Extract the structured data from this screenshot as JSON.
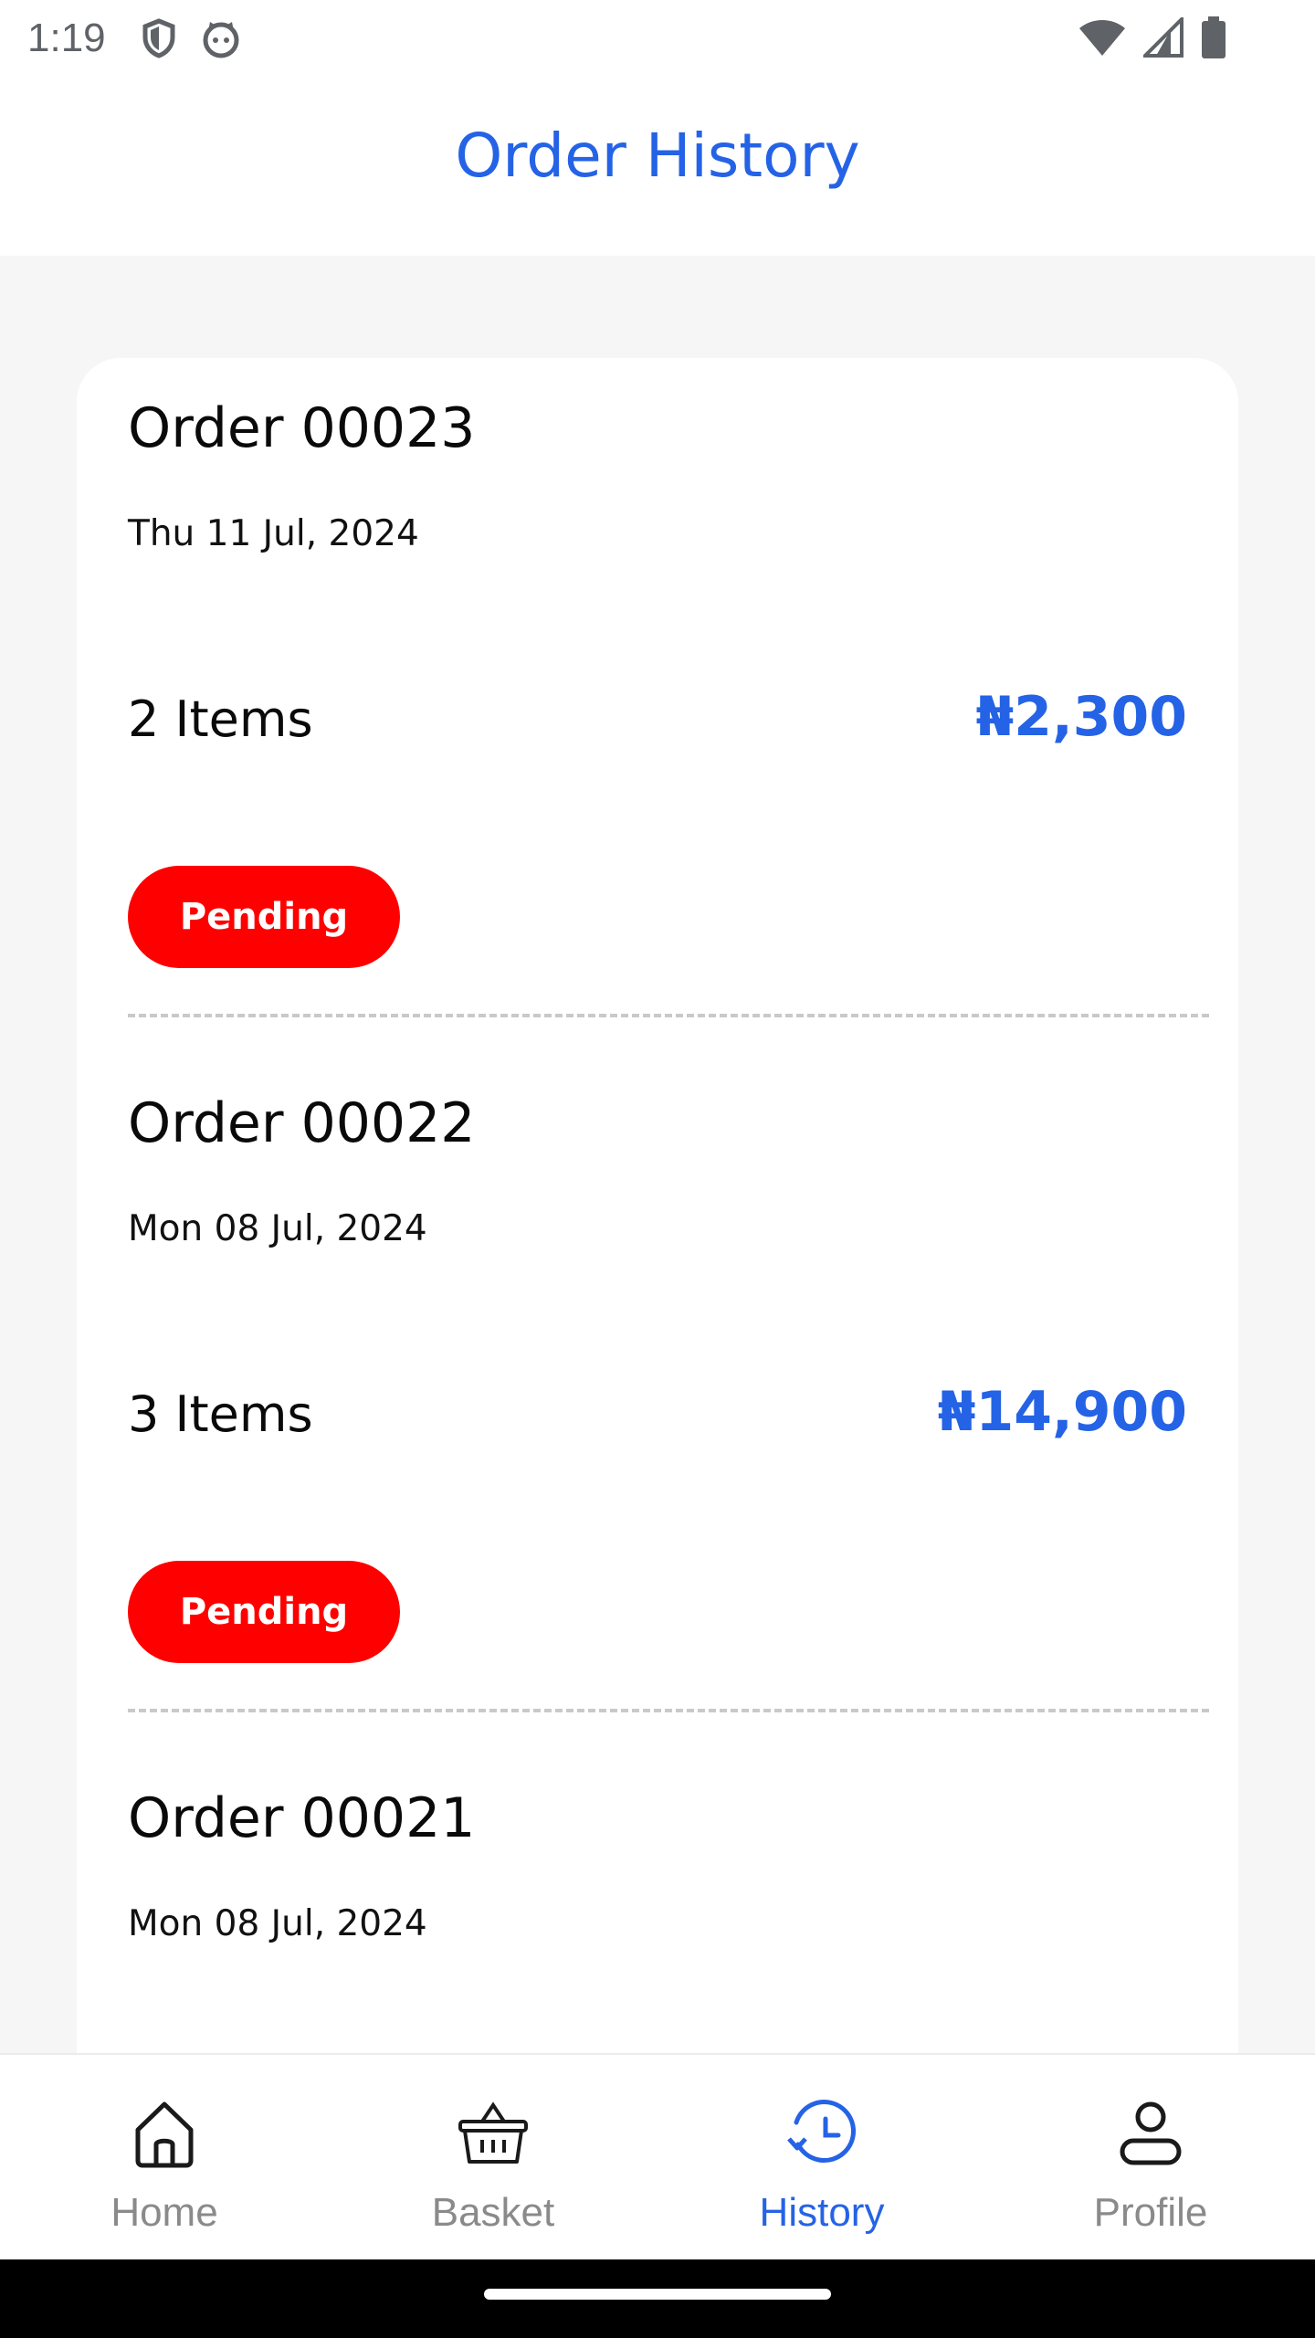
{
  "status_bar": {
    "time": "1:19",
    "icons": [
      "shield-icon",
      "cat-face-icon",
      "wifi-icon",
      "signal-icon",
      "battery-icon"
    ]
  },
  "header": {
    "title": "Order History"
  },
  "orders": [
    {
      "title": "Order 00023",
      "date": "Thu 11 Jul, 2024",
      "items": "2 Items",
      "price": "₦2,300",
      "status": "Pending"
    },
    {
      "title": "Order 00022",
      "date": "Mon 08 Jul, 2024",
      "items": "3 Items",
      "price": "₦14,900",
      "status": "Pending"
    },
    {
      "title": "Order 00021",
      "date": "Mon 08 Jul, 2024"
    }
  ],
  "nav": {
    "items": [
      {
        "label": "Home",
        "icon": "home-icon",
        "active": false
      },
      {
        "label": "Basket",
        "icon": "basket-icon",
        "active": false
      },
      {
        "label": "History",
        "icon": "history-icon",
        "active": true
      },
      {
        "label": "Profile",
        "icon": "profile-icon",
        "active": false
      }
    ]
  },
  "colors": {
    "accent": "#2563e6",
    "status_pending": "#ff0000",
    "inactive": "#8a8a8a"
  }
}
